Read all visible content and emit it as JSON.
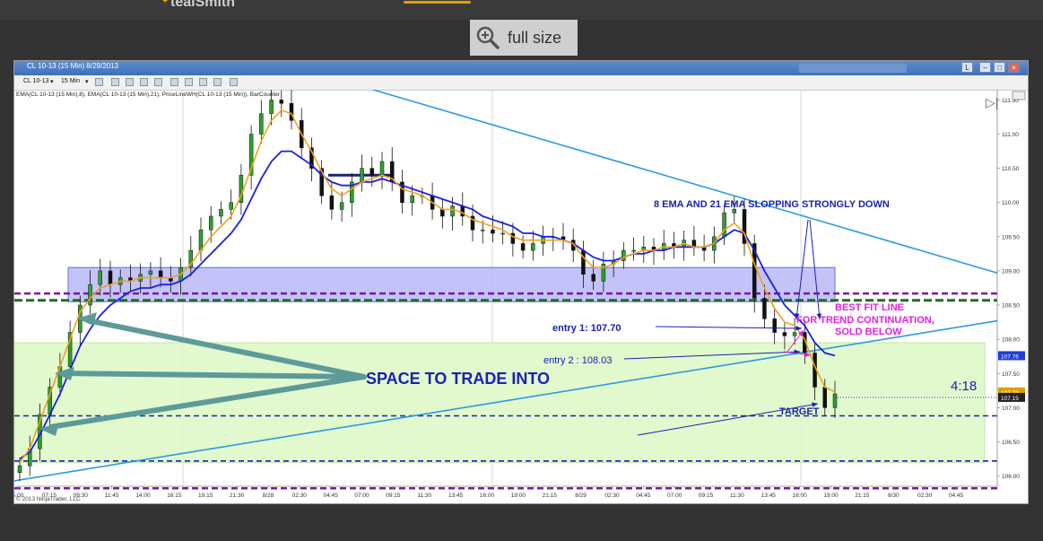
{
  "header": {
    "logo_text": "tealSmith"
  },
  "full_size_button": {
    "label": "full size"
  },
  "window": {
    "title": "CL 10-13 (15 Min)  8/29/2013",
    "instrument_selector": "CL 10-13",
    "interval_selector": "15 Min",
    "copyright": "© 2013 NinjaTrader, LLC",
    "indicator_legend": "EMA(CL 10-13 (15 Min),8), EMA(CL 10-13 (15 Min),21), PriceLineWH(CL 10-13 (15 Min)), BarCounter",
    "countdown": "4:18"
  },
  "chart_data": {
    "type": "candlestick",
    "ylim": [
      105.85,
      111.65
    ],
    "y_ticks": [
      "111.50",
      "111.00",
      "110.50",
      "110.00",
      "109.50",
      "109.00",
      "108.50",
      "108.00",
      "107.50",
      "107.00",
      "106.50",
      "106.00"
    ],
    "x_ticks": [
      "5:00",
      "07:15",
      "09:30",
      "11:45",
      "14:00",
      "16:15",
      "19:15",
      "21:30",
      "8/28",
      "02:30",
      "04:45",
      "07:00",
      "09:15",
      "11:30",
      "13:45",
      "16:00",
      "19:00",
      "21:15",
      "8/29",
      "02:30",
      "04:45",
      "07:00",
      "09:15",
      "11:30",
      "13:45",
      "16:00",
      "19:00",
      "21:15",
      "8/30",
      "02:30",
      "04:45"
    ],
    "price_labels": [
      {
        "text": "107.76",
        "value": 107.76,
        "color": "#1f3fd8"
      },
      {
        "text": "107.23",
        "value": 107.23,
        "color": "#e0a000"
      },
      {
        "text": "107.15",
        "value": 107.15,
        "color": "#222222"
      }
    ],
    "closes": [
      106.15,
      106.4,
      106.9,
      107.3,
      107.6,
      108.1,
      108.5,
      108.8,
      109.0,
      108.8,
      108.9,
      108.85,
      108.95,
      109.0,
      108.9,
      108.85,
      109.05,
      109.3,
      109.6,
      109.8,
      109.9,
      110.0,
      110.4,
      111.0,
      111.3,
      111.5,
      111.45,
      111.2,
      110.8,
      110.5,
      110.1,
      109.9,
      110.0,
      110.3,
      110.5,
      110.4,
      110.6,
      110.3,
      110.0,
      110.1,
      110.1,
      109.9,
      109.8,
      109.95,
      109.8,
      109.6,
      109.6,
      109.55,
      109.55,
      109.4,
      109.3,
      109.4,
      109.5,
      109.5,
      109.45,
      109.3,
      108.95,
      108.85,
      109.1,
      109.15,
      109.3,
      109.3,
      109.35,
      109.3,
      109.4,
      109.35,
      109.45,
      109.35,
      109.3,
      109.5,
      109.85,
      109.9,
      109.4,
      108.6,
      108.3,
      108.1,
      108.05,
      108.1,
      107.8,
      107.3,
      107.0,
      107.2
    ],
    "ema8": [
      106.2,
      106.4,
      106.8,
      107.2,
      107.6,
      108.0,
      108.4,
      108.6,
      108.75,
      108.8,
      108.85,
      108.85,
      108.9,
      108.9,
      108.9,
      108.9,
      108.95,
      109.1,
      109.3,
      109.5,
      109.65,
      109.8,
      110.1,
      110.5,
      110.9,
      111.2,
      111.35,
      111.3,
      111.0,
      110.75,
      110.45,
      110.2,
      110.1,
      110.2,
      110.3,
      110.35,
      110.4,
      110.35,
      110.2,
      110.15,
      110.1,
      110.0,
      109.9,
      109.9,
      109.85,
      109.75,
      109.7,
      109.65,
      109.6,
      109.5,
      109.45,
      109.45,
      109.45,
      109.45,
      109.45,
      109.4,
      109.2,
      109.05,
      109.05,
      109.1,
      109.2,
      109.25,
      109.3,
      109.3,
      109.35,
      109.35,
      109.4,
      109.35,
      109.35,
      109.4,
      109.6,
      109.7,
      109.55,
      109.1,
      108.75,
      108.45,
      108.25,
      108.2,
      108.0,
      107.6,
      107.3,
      107.23
    ],
    "ema21": [
      106.25,
      106.35,
      106.6,
      106.9,
      107.2,
      107.55,
      107.9,
      108.15,
      108.35,
      108.5,
      108.6,
      108.7,
      108.75,
      108.75,
      108.8,
      108.8,
      108.85,
      108.95,
      109.1,
      109.25,
      109.4,
      109.55,
      109.75,
      110.05,
      110.35,
      110.6,
      110.75,
      110.75,
      110.65,
      110.55,
      110.4,
      110.3,
      110.25,
      110.25,
      110.3,
      110.3,
      110.35,
      110.3,
      110.25,
      110.2,
      110.15,
      110.1,
      110.05,
      110.0,
      109.95,
      109.9,
      109.8,
      109.75,
      109.7,
      109.65,
      109.55,
      109.55,
      109.5,
      109.5,
      109.45,
      109.4,
      109.3,
      109.2,
      109.15,
      109.15,
      109.2,
      109.25,
      109.25,
      109.3,
      109.3,
      109.35,
      109.35,
      109.35,
      109.35,
      109.4,
      109.5,
      109.6,
      109.55,
      109.3,
      109.0,
      108.75,
      108.5,
      108.35,
      108.2,
      107.95,
      107.8,
      107.76
    ],
    "series": [
      {
        "name": "EMA(8)",
        "color": "#f0a020"
      },
      {
        "name": "EMA(21)",
        "color": "#1a22d8"
      }
    ]
  },
  "annotations": {
    "space_label": "SPACE TO TRADE INTO",
    "ema_note": "8 EMA AND 21 EMA SLOPPING STRONGLY DOWN",
    "best_fit_1": "BEST FIT LINE",
    "best_fit_2": "FOR TREND CONTINUATION,",
    "best_fit_3": "SOLD BELOW",
    "entry1": "entry 1: 107.70",
    "entry2": "entry 2 : 108.03",
    "target": "TARGET"
  },
  "colors": {
    "purple_line": "#7a1a9a",
    "green_dashed": "#1e6e1e",
    "blue_dashed": "#1a22b0",
    "trend_line": "#2a9ae0",
    "space_arrow": "#5e9a98",
    "resistance_box": "#b8b8f8",
    "space_box": "#dff8c8",
    "annotation_blue": "#1a22b0",
    "annotation_magenta": "#e020e0"
  }
}
